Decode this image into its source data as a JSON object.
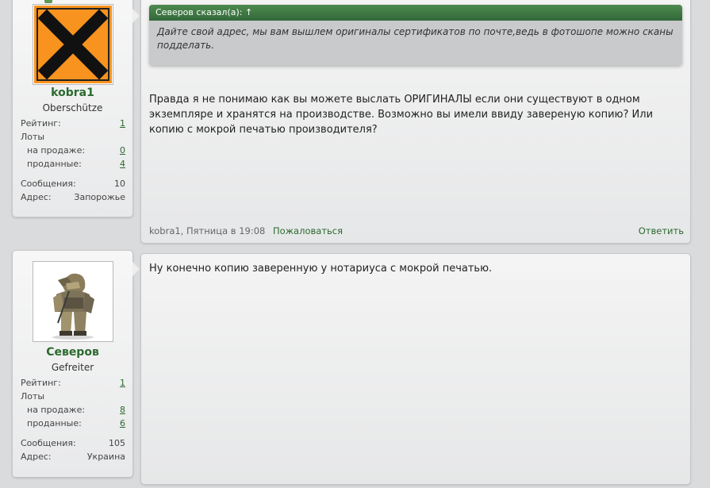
{
  "posts": [
    {
      "username": "kobra1",
      "rank": "Oberschütze",
      "avatar_icon": "hazard-x-icon",
      "stats": {
        "rating_label": "Рейтинг:",
        "rating": "1",
        "lots_label": "Лоты",
        "selling_label": "на продаже:",
        "selling": "0",
        "sold_label": "проданные:",
        "sold": "4",
        "messages_label": "Сообщения:",
        "messages": "10",
        "address_label": "Адрес:",
        "address": "Запорожье"
      },
      "quote": {
        "header": "Северов сказал(а): ↑",
        "text": "Дайте свой адрес, мы вам вышлем оригиналы сертификатов по почте,ведь в фотошопе можно сканы подделать."
      },
      "text": "Правда я не понимаю как вы можете выслать ОРИГИНАЛЫ если они существуют в одном экземпляре и хранятся на производстве. Возможно вы имели ввиду завереную копию? Или копию с мокрой печатью производителя?",
      "footer": {
        "meta": "kobra1, Пятница в 19:08",
        "complain": "Пожаловаться",
        "reply": "Ответить"
      }
    },
    {
      "username": "Северов",
      "rank": "Gefreiter",
      "avatar_icon": "soldier-photo",
      "stats": {
        "rating_label": "Рейтинг:",
        "rating": "1",
        "lots_label": "Лоты",
        "selling_label": "на продаже:",
        "selling": "8",
        "sold_label": "проданные:",
        "sold": "6",
        "messages_label": "Сообщения:",
        "messages": "105",
        "address_label": "Адрес:",
        "address": "Украина"
      },
      "text": "Ну конечно копию заверенную у нотариуса с мокрой печатью."
    }
  ]
}
